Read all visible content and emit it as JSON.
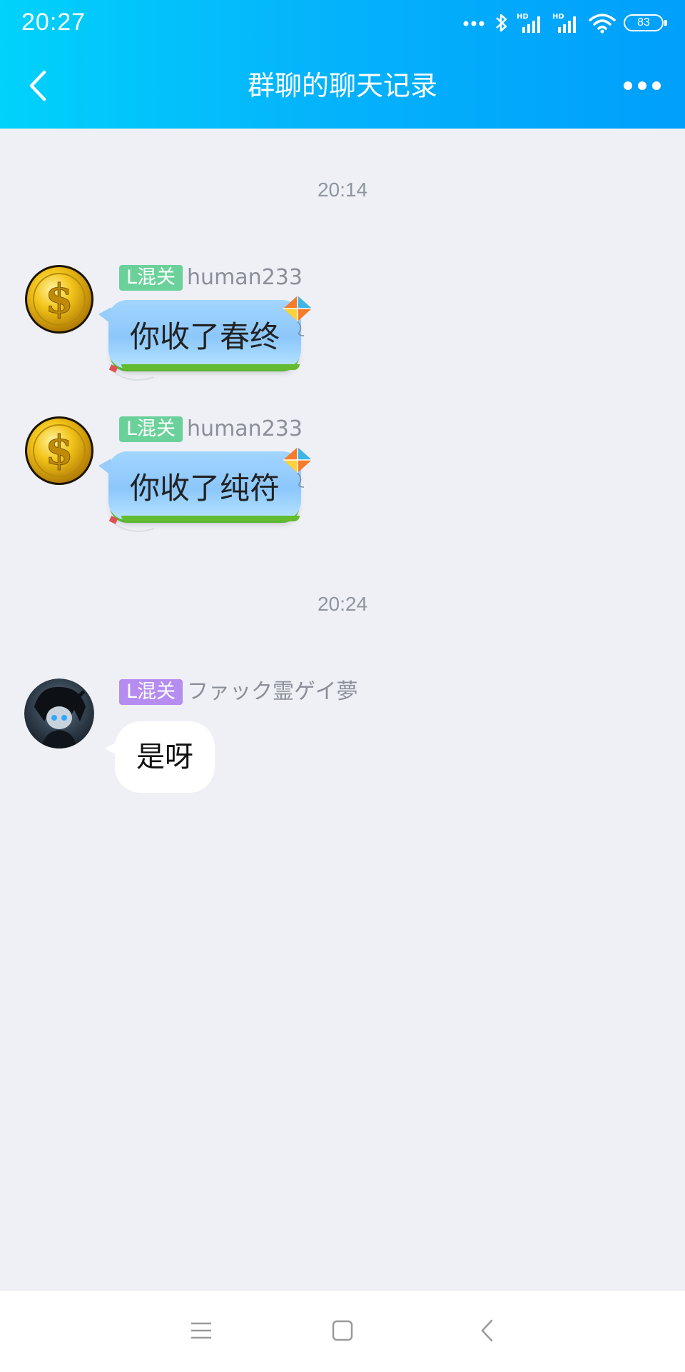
{
  "status_bar": {
    "time": "20:27",
    "battery": "83",
    "icons": [
      "more-dots-icon",
      "bluetooth-icon",
      "hd-signal-icon",
      "hd-signal-icon",
      "wifi-icon",
      "battery-icon"
    ]
  },
  "nav": {
    "title": "群聊的聊天记录",
    "back_icon": "chevron-left-icon",
    "more_icon": "more-horizontal-icon"
  },
  "colors": {
    "header_gradient_start": "#00d2fb",
    "header_gradient_end": "#009ffb",
    "background": "#eff0f6",
    "badge_green": "#6bd19a",
    "badge_purple": "#b58cf0",
    "timestamp_text": "#8f959f"
  },
  "messages": [
    {
      "type": "time",
      "text": "20:14"
    },
    {
      "type": "message",
      "badge": "L混关",
      "badge_color": "green",
      "sender": "human233",
      "avatar_icon": "gold-dollar-coin-avatar",
      "text": "你收了春终",
      "bubble_style": "kite-theme"
    },
    {
      "type": "message",
      "badge": "L混关",
      "badge_color": "green",
      "sender": "human233",
      "avatar_icon": "gold-dollar-coin-avatar",
      "text": "你收了纯符",
      "bubble_style": "kite-theme"
    },
    {
      "type": "time",
      "text": "20:24"
    },
    {
      "type": "message",
      "badge": "L混关",
      "badge_color": "purple",
      "sender": "ファック霊ゲイ夢",
      "avatar_icon": "anime-character-avatar",
      "text": "是呀",
      "bubble_style": "white"
    }
  ],
  "system_nav": {
    "buttons": [
      "menu-icon",
      "home-square-icon",
      "back-chevron-icon"
    ]
  }
}
